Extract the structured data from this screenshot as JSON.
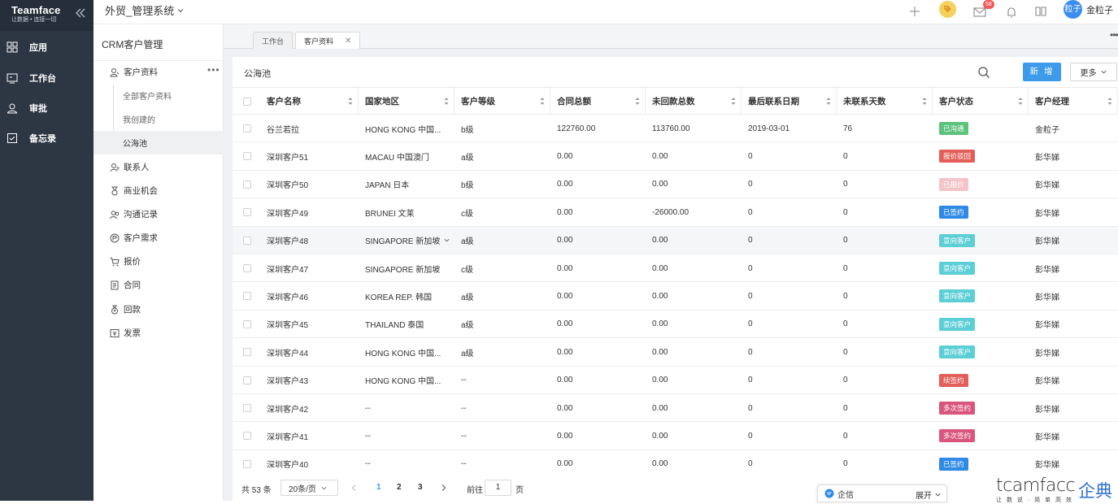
{
  "app": {
    "brand": "Teamface",
    "slogan": "让数据 • 连接一切"
  },
  "leftnav": {
    "items": [
      {
        "label": "应用",
        "icon": "apps-grid-icon"
      },
      {
        "label": "工作台",
        "icon": "workbench-icon"
      },
      {
        "label": "审批",
        "icon": "approval-user-icon"
      },
      {
        "label": "备忘录",
        "icon": "memo-icon"
      }
    ]
  },
  "topbar": {
    "system_name": "外贸_管理系统",
    "mail_count": "58",
    "avatar_text": "粒子",
    "username": "金粒子"
  },
  "module": {
    "title": "CRM客户管理",
    "menu": [
      {
        "label": "客户资料",
        "icon": "customer-icon"
      },
      {
        "label": "联系人",
        "icon": "contact-icon"
      },
      {
        "label": "商业机会",
        "icon": "opportunity-icon"
      },
      {
        "label": "沟通记录",
        "icon": "communication-icon"
      },
      {
        "label": "客户需求",
        "icon": "demand-icon"
      },
      {
        "label": "报价",
        "icon": "quote-cart-icon"
      },
      {
        "label": "合同",
        "icon": "contract-icon"
      },
      {
        "label": "回款",
        "icon": "payment-icon"
      },
      {
        "label": "发票",
        "icon": "invoice-icon"
      }
    ],
    "sub": [
      {
        "label": "全部客户资料"
      },
      {
        "label": "我创建的"
      },
      {
        "label": "公海池"
      }
    ]
  },
  "tabs": [
    {
      "label": "工作台"
    },
    {
      "label": "客户资料"
    }
  ],
  "page": {
    "title": "公海池",
    "new_label": "新 增",
    "more_label": "更多"
  },
  "table": {
    "columns": [
      "客户名称",
      "国家地区",
      "客户等级",
      "合同总额",
      "未回款总数",
      "最后联系日期",
      "未联系天数",
      "客户状态",
      "客户经理"
    ],
    "rows": [
      {
        "name": "谷兰若拉",
        "country": "HONG KONG 中国...",
        "level": "b级",
        "contract": "122760.00",
        "unpaid": "113760.00",
        "last": "2019-03-01",
        "days": "76",
        "status": "已沟通",
        "status_color": "#5dc27c",
        "manager": "金粒子"
      },
      {
        "name": "深圳客户51",
        "country": "MACAU 中国澳门",
        "level": "a级",
        "contract": "0.00",
        "unpaid": "0.00",
        "last": "0",
        "days": "0",
        "status": "报价驳回",
        "status_color": "#e35e58",
        "manager": "彭华娣"
      },
      {
        "name": "深圳客户50",
        "country": "JAPAN 日本",
        "level": "b级",
        "contract": "0.00",
        "unpaid": "0.00",
        "last": "0",
        "days": "0",
        "status": "已报价",
        "status_color": "#f4c4c8",
        "manager": "彭华娣"
      },
      {
        "name": "深圳客户49",
        "country": "BRUNEI 文莱",
        "level": "c级",
        "contract": "0.00",
        "unpaid": "-26000.00",
        "last": "0",
        "days": "0",
        "status": "已签约",
        "status_color": "#2f8ae6",
        "manager": "彭华娣"
      },
      {
        "name": "深圳客户48",
        "country": "SINGAPORE 新加坡",
        "level": "a级",
        "contract": "0.00",
        "unpaid": "0.00",
        "last": "0",
        "days": "0",
        "status": "意向客户",
        "status_color": "#5ccfd6",
        "manager": "彭华娣"
      },
      {
        "name": "深圳客户47",
        "country": "SINGAPORE 新加坡",
        "level": "c级",
        "contract": "0.00",
        "unpaid": "0.00",
        "last": "0",
        "days": "0",
        "status": "意向客户",
        "status_color": "#5ccfd6",
        "manager": "彭华娣"
      },
      {
        "name": "深圳客户46",
        "country": "KOREA REP. 韩国",
        "level": "a级",
        "contract": "0.00",
        "unpaid": "0.00",
        "last": "0",
        "days": "0",
        "status": "意向客户",
        "status_color": "#5ccfd6",
        "manager": "彭华娣"
      },
      {
        "name": "深圳客户45",
        "country": "THAILAND 泰国",
        "level": "a级",
        "contract": "0.00",
        "unpaid": "0.00",
        "last": "0",
        "days": "0",
        "status": "意向客户",
        "status_color": "#5ccfd6",
        "manager": "彭华娣"
      },
      {
        "name": "深圳客户44",
        "country": "HONG KONG 中国...",
        "level": "a级",
        "contract": "0.00",
        "unpaid": "0.00",
        "last": "0",
        "days": "0",
        "status": "意向客户",
        "status_color": "#5ccfd6",
        "manager": "彭华娣"
      },
      {
        "name": "深圳客户43",
        "country": "HONG KONG 中国...",
        "level": "--",
        "contract": "0.00",
        "unpaid": "0.00",
        "last": "0",
        "days": "0",
        "status": "续签约",
        "status_color": "#e35e58",
        "manager": "彭华娣"
      },
      {
        "name": "深圳客户42",
        "country": "--",
        "level": "--",
        "contract": "0.00",
        "unpaid": "0.00",
        "last": "0",
        "days": "0",
        "status": "多次签约",
        "status_color": "#d9557d",
        "manager": "彭华娣"
      },
      {
        "name": "深圳客户41",
        "country": "--",
        "level": "--",
        "contract": "0.00",
        "unpaid": "0.00",
        "last": "0",
        "days": "0",
        "status": "多次签约",
        "status_color": "#d9557d",
        "manager": "彭华娣"
      },
      {
        "name": "深圳客户40",
        "country": "--",
        "level": "--",
        "contract": "0.00",
        "unpaid": "0.00",
        "last": "0",
        "days": "0",
        "status": "已签约",
        "status_color": "#2f8ae6",
        "manager": "彭华娣"
      }
    ]
  },
  "pagination": {
    "total": "共 53 条",
    "page_size": "20条/页",
    "pages": [
      "1",
      "2",
      "3"
    ],
    "goto": "前往",
    "goto_value": "1",
    "page_suffix": "页"
  },
  "qixin": {
    "label": "企信",
    "expand": "展开"
  },
  "watermark": {
    "en": "tcamfacc",
    "cn": "企典",
    "sub": "让 数 说 · 简 单 高 效"
  }
}
